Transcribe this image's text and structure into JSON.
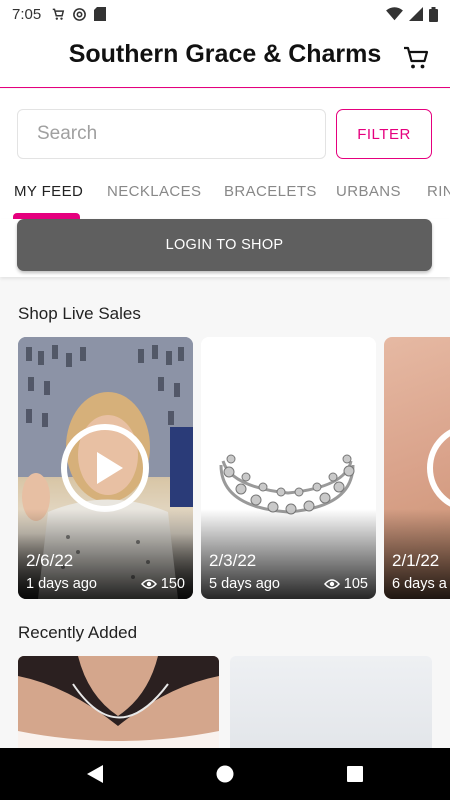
{
  "status_bar": {
    "time": "7:05"
  },
  "header": {
    "title": "Southern Grace & Charms"
  },
  "search": {
    "placeholder": "Search",
    "filter_label": "FILTER"
  },
  "tabs": [
    {
      "label": "MY FEED",
      "active": true
    },
    {
      "label": "NECKLACES"
    },
    {
      "label": "BRACELETS"
    },
    {
      "label": "URBANS"
    },
    {
      "label": "RIN"
    }
  ],
  "login": {
    "label": "LOGIN TO SHOP"
  },
  "live_sales": {
    "title": "Shop Live Sales",
    "cards": [
      {
        "date": "2/6/22",
        "ago": "1 days ago",
        "views": "150"
      },
      {
        "date": "2/3/22",
        "ago": "5 days ago",
        "views": "105"
      },
      {
        "date": "2/1/22",
        "ago": "6 days a"
      }
    ]
  },
  "recently_added": {
    "title": "Recently Added"
  },
  "colors": {
    "accent": "#e5007e",
    "login_bg": "#5f5f5f"
  }
}
